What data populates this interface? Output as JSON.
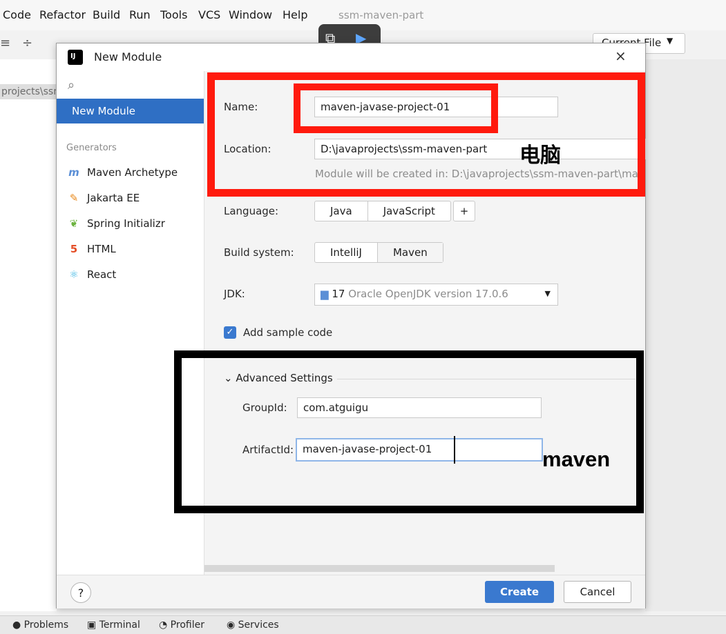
{
  "menu": {
    "items": [
      "Code",
      "Refactor",
      "Build",
      "Run",
      "Tools",
      "VCS",
      "Window",
      "Help"
    ],
    "project_title": "ssm-maven-part"
  },
  "toolbar": {
    "current_file": "Current File"
  },
  "sidebar_bg": {
    "path": "projects\\ssn"
  },
  "dialog": {
    "title": "New Module",
    "close": "×",
    "selected_item": "New Module",
    "generators_header": "Generators",
    "generators": [
      "Maven Archetype",
      "Jakarta EE",
      "Spring Initializr",
      "HTML",
      "React"
    ]
  },
  "form": {
    "name_label": "Name:",
    "name_value": "maven-javase-project-01",
    "location_label": "Location:",
    "location_value": "D:\\javaprojects\\ssm-maven-part",
    "location_hint": "Module will be created in: D:\\javaprojects\\ssm-maven-part\\mave",
    "language_label": "Language:",
    "languages": [
      "Java",
      "JavaScript"
    ],
    "add_language": "+",
    "build_label": "Build system:",
    "build_systems": [
      "IntelliJ",
      "Maven"
    ],
    "jdk_label": "JDK:",
    "jdk_version": "17",
    "jdk_desc": "Oracle OpenJDK version 17.0.6",
    "sample_code_label": "Add sample code",
    "advanced_label": "Advanced Settings",
    "groupid_label": "GroupId:",
    "groupid_value": "com.atguigu",
    "artifactid_label": "ArtifactId:",
    "artifactid_value": "maven-javase-project-01"
  },
  "buttons": {
    "help": "?",
    "create": "Create",
    "cancel": "Cancel"
  },
  "annotations": {
    "computer": "电脑",
    "maven": "maven"
  },
  "statusbar": {
    "tabs": [
      "Problems",
      "Terminal",
      "Profiler",
      "Services"
    ]
  },
  "colors": {
    "accent": "#3a79cf",
    "annotation_red": "#ff1a0d",
    "annotation_black": "#000000"
  }
}
